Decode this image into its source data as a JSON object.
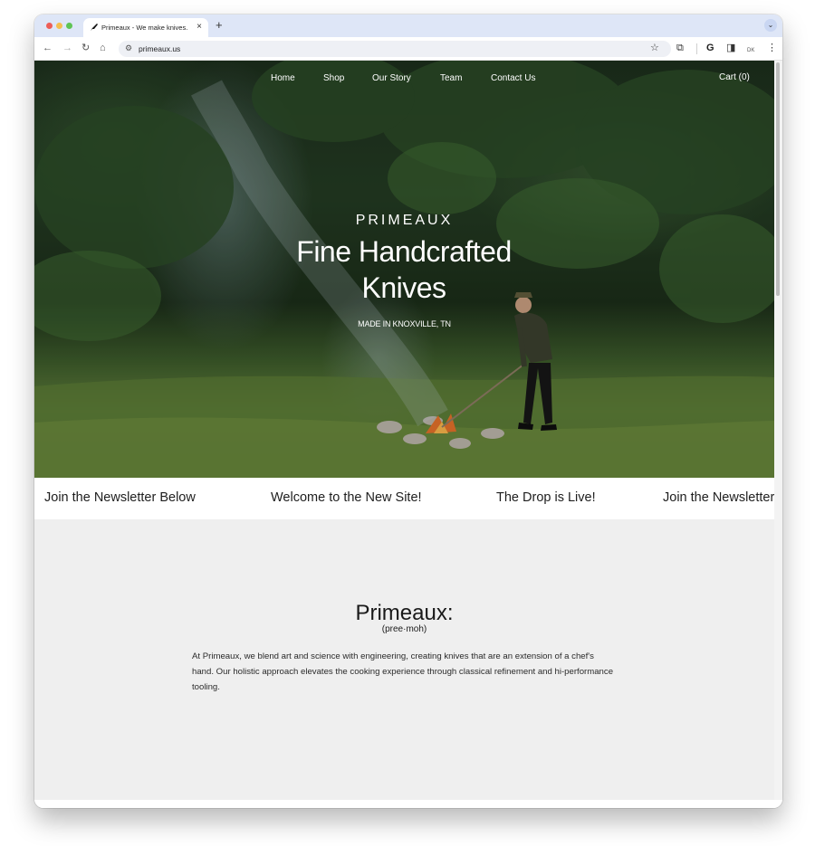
{
  "browser": {
    "tab_title": "Primeaux - We make knives.",
    "tab_favicon": "knife-logo-icon",
    "tab_close": "×",
    "new_tab": "+",
    "url": "primeaux.us",
    "profile_label": "DK"
  },
  "site": {
    "nav": [
      {
        "label": "Home"
      },
      {
        "label": "Shop"
      },
      {
        "label": "Our Story"
      },
      {
        "label": "Team"
      },
      {
        "label": "Contact Us"
      }
    ],
    "cart_label": "Cart (0)",
    "hero": {
      "brand": "PRIMEAUX",
      "headline": "Fine Handcrafted Knives",
      "tagline": "MADE IN KNOXVILLE, TN"
    },
    "marquee": [
      "Join the Newsletter Below",
      "Welcome to the New Site!",
      "The Drop is Live!",
      "Join the Newsletter Below"
    ],
    "about": {
      "title": "Primeaux:",
      "phonetic": "(pree·moh)",
      "body": "At Primeaux, we blend art and science with engineering, creating knives that are an extension of a chef's hand. Our holistic approach elevates the cooking experience through classical refinement and hi-performance tooling."
    }
  },
  "colors": {
    "tab_strip": "#dee6f7",
    "page_background": "#efefef",
    "hero_green": "#1c2e1c"
  }
}
